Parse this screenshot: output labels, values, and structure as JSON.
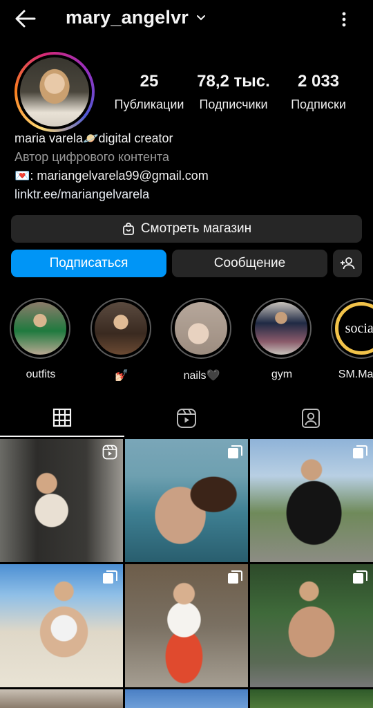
{
  "header": {
    "username": "mary_angelvr"
  },
  "stats": [
    {
      "value": "25",
      "label": "Публикации"
    },
    {
      "value": "78,2 тыс.",
      "label": "Подписчики"
    },
    {
      "value": "2 033",
      "label": "Подписки"
    }
  ],
  "bio": {
    "line1": "maria varela🪐digital creator",
    "category": "Автор цифрового контента",
    "email": "💌: mariangelvarela99@gmail.com",
    "link": "linktr.ee/mariangelvarela"
  },
  "actions": {
    "shop": "Смотреть магазин",
    "follow": "Подписаться",
    "message": "Сообщение"
  },
  "highlights": [
    {
      "name": "outfits"
    },
    {
      "name": "💅🏻"
    },
    {
      "name": "nails🖤"
    },
    {
      "name": "gym"
    },
    {
      "name": "SM.Mana",
      "cover_text": "social"
    }
  ],
  "colors": {
    "follow_button": "#0095f6",
    "secondary_button": "#262626",
    "background": "#000000",
    "muted_text": "#9a9a9a"
  },
  "icons": {
    "back": "arrow-left-icon",
    "more": "more-vertical-icon",
    "grid_tab": "grid-icon",
    "reels_tab": "reels-icon",
    "tagged_tab": "tagged-person-icon"
  }
}
